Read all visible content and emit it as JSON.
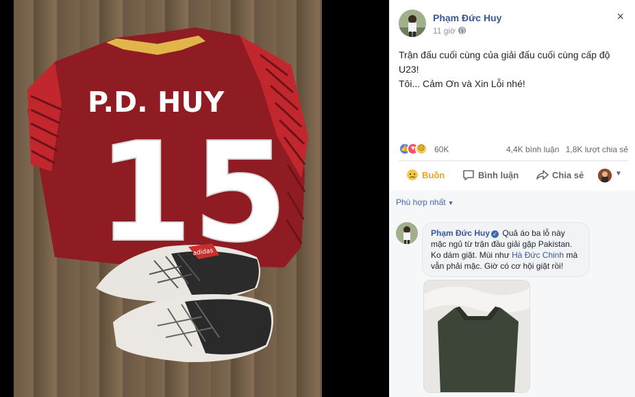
{
  "photo": {
    "jersey_name": "P.D. HUY",
    "jersey_number": "15",
    "boot_brand_text": "adidas"
  },
  "post": {
    "author": "Phạm Đức Huy",
    "time": "11 giờ",
    "privacy_icon": "globe-icon",
    "text_line1": "Trận đấu cuối cùng của giải đấu cuối cùng cấp độ U23!",
    "text_line2": "Tôi... Cảm Ơn và Xin Lỗi nhé!",
    "reactions_count": "60K",
    "comments_count": "4,4K bình luận",
    "shares_count": "1,8K lượt chia sẻ",
    "close_symbol": "×"
  },
  "actions": {
    "reaction_label": "Buồn",
    "comment_label": "Bình luận",
    "share_label": "Chia sẻ"
  },
  "comments": {
    "sort_label": "Phù hợp nhất",
    "items": [
      {
        "author": "Phạm Đức Huy",
        "text_before": " Quả áo ba lỗ này mặc ngủ từ trận đầu giải gặp Pakistan. Ko dám giặt. Mùi như ",
        "mention": "Hà Đức Chinh",
        "text_after": " mà vẫn phải mặc. Giờ có cơ hội giặt rồi!"
      }
    ]
  },
  "colors": {
    "link_blue": "#365899",
    "sad_orange": "#e9a321",
    "jersey_red": "#9c1f24"
  }
}
